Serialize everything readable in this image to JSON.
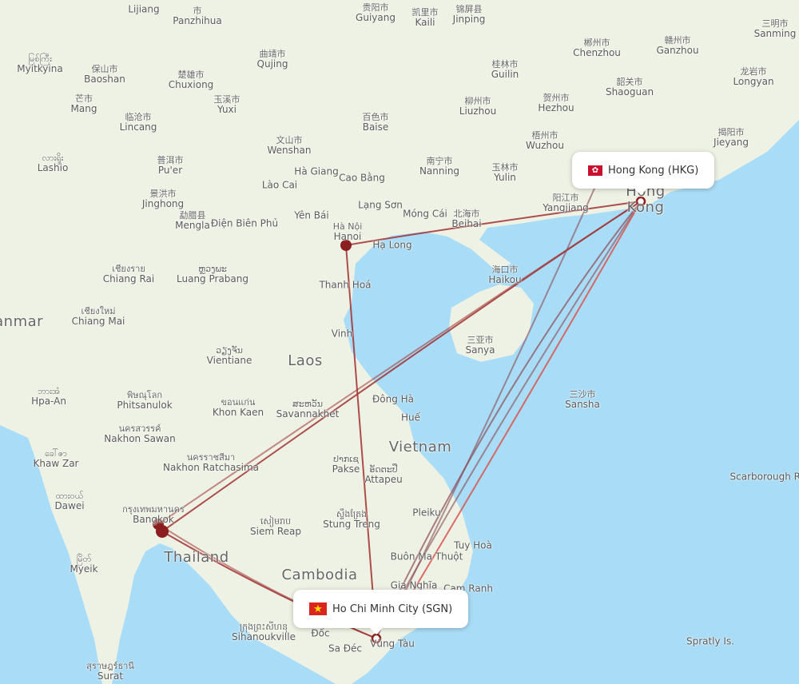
{
  "map": {
    "colors": {
      "sea": "#a9dcf6",
      "land": "#eef2e4",
      "route": "#a03030",
      "route_alt": "#d9534f",
      "airport": "#8b1e1e"
    },
    "origin": {
      "name": "Hong Kong (HKG)",
      "flag_icon": "hong-kong-flag"
    },
    "destination": {
      "name": "Ho Chi Minh City (SGN)",
      "flag_icon": "vietnam-flag"
    },
    "places": [
      {
        "name": "Lijiang",
        "native": ""
      },
      {
        "name": "Panzhihua",
        "native": "市"
      },
      {
        "name": "Guiyang",
        "native": "贵阳市"
      },
      {
        "name": "Kaili",
        "native": "凯里市"
      },
      {
        "name": "Jinping",
        "native": "锦屏县"
      },
      {
        "name": "Sanming",
        "native": "三明市"
      },
      {
        "name": "Myitkyina",
        "native": "မြစ်ကြီး"
      },
      {
        "name": "Baoshan",
        "native": "保山市"
      },
      {
        "name": "Qujing",
        "native": "曲靖市"
      },
      {
        "name": "Chuxiong",
        "native": "楚雄市"
      },
      {
        "name": "Yuxi",
        "native": "玉溪市"
      },
      {
        "name": "Mang",
        "native": "芒市"
      },
      {
        "name": "Lincang",
        "native": "临沧市"
      },
      {
        "name": "Baise",
        "native": "百色市"
      },
      {
        "name": "Wenshan",
        "native": "文山市"
      },
      {
        "name": "Chenzhou",
        "native": "郴州市"
      },
      {
        "name": "Ganzhou",
        "native": "赣州市"
      },
      {
        "name": "Guilin",
        "native": "桂林市"
      },
      {
        "name": "Longyan",
        "native": "龙岩市"
      },
      {
        "name": "Shaoguan",
        "native": "韶关市"
      },
      {
        "name": "Hezhou",
        "native": "贺州市"
      },
      {
        "name": "Liuzhou",
        "native": "柳州市"
      },
      {
        "name": "Jieyang",
        "native": "揭阳市"
      },
      {
        "name": "Wuzhou",
        "native": "梧州市"
      },
      {
        "name": "Lashio",
        "native": "လားရှိုး"
      },
      {
        "name": "Pu'er",
        "native": "普洱市"
      },
      {
        "name": "Nanning",
        "native": "南宁市"
      },
      {
        "name": "Yulin",
        "native": "玉林市"
      },
      {
        "name": "Hà Giang",
        "native": ""
      },
      {
        "name": "Cao Bằng",
        "native": ""
      },
      {
        "name": "Lào Cai",
        "native": ""
      },
      {
        "name": "Jinghong",
        "native": "景洪市"
      },
      {
        "name": "Mengla",
        "native": "勐腊县"
      },
      {
        "name": "Điện Biên Phủ",
        "native": ""
      },
      {
        "name": "Yên Bái",
        "native": ""
      },
      {
        "name": "Lạng Sơn",
        "native": ""
      },
      {
        "name": "Móng Cái",
        "native": ""
      },
      {
        "name": "Beihai",
        "native": "北海市"
      },
      {
        "name": "Yangjiang",
        "native": "阳江市"
      },
      {
        "name": "Hanoi",
        "native": "Hà Nội"
      },
      {
        "name": "Hạ Long",
        "native": ""
      },
      {
        "name": "Haikou",
        "native": "海口市"
      },
      {
        "name": "Chiang Rai",
        "native": "เชียงราย"
      },
      {
        "name": "Luang Prabang",
        "native": "ຫຼວງພະ"
      },
      {
        "name": "Thanh Hoá",
        "native": ""
      },
      {
        "name": "Chiang Mai",
        "native": "เชียงใหม่"
      },
      {
        "name": "Vinh",
        "native": ""
      },
      {
        "name": "Sanya",
        "native": "三亚市"
      },
      {
        "name": "Vientiane",
        "native": "ວຽງຈັນ"
      },
      {
        "name": "Sansha",
        "native": "三沙市"
      },
      {
        "name": "Hpa-An",
        "native": "ဘားအံ"
      },
      {
        "name": "Phitsanulok",
        "native": "พิษณุโลก"
      },
      {
        "name": "Khon Kaen",
        "native": "ขอนแก่น"
      },
      {
        "name": "Savannakhet",
        "native": "ສະຫວັນ"
      },
      {
        "name": "Đông Hà",
        "native": ""
      },
      {
        "name": "Huế",
        "native": ""
      },
      {
        "name": "Nakhon Sawan",
        "native": "นครสวรรค์"
      },
      {
        "name": "Khaw Zar",
        "native": "ခေါ်ဇာ"
      },
      {
        "name": "Pakse",
        "native": "ປາກເຊ"
      },
      {
        "name": "Attapeu",
        "native": "ອັດຕະປື"
      },
      {
        "name": "Nakhon Ratchasima",
        "native": "นครราชสีมา"
      },
      {
        "name": "Scarborough Reef",
        "native": ""
      },
      {
        "name": "Dawei",
        "native": "ထားဝယ်"
      },
      {
        "name": "Bangkok",
        "native": "กรุงเทพมหานคร"
      },
      {
        "name": "Pleiku",
        "native": ""
      },
      {
        "name": "Stung Treng",
        "native": "ស្ទឹងត្រែង"
      },
      {
        "name": "Siem Reap",
        "native": "សៀមរាប"
      },
      {
        "name": "Tuy Hoà",
        "native": ""
      },
      {
        "name": "Buôn Ma Thuột",
        "native": ""
      },
      {
        "name": "Myeik",
        "native": "မြိတ်"
      },
      {
        "name": "Gia Nghĩa",
        "native": ""
      },
      {
        "name": "Cam Ranh",
        "native": ""
      },
      {
        "name": "Sihanoukville",
        "native": "ក្រុងព្រះសីហនុ"
      },
      {
        "name": "Vũng Tàu",
        "native": ""
      },
      {
        "name": "Spratly Is.",
        "native": ""
      },
      {
        "name": "Sa Đéc",
        "native": ""
      },
      {
        "name": "Đốc",
        "native": ""
      },
      {
        "name": "Surat",
        "native": "สุราษฎร์ธานี"
      }
    ],
    "countries": [
      "Laos",
      "Vietnam",
      "Thailand",
      "Cambodia",
      "Myanmar"
    ],
    "cities_partial": [
      "Hong Kong"
    ]
  }
}
